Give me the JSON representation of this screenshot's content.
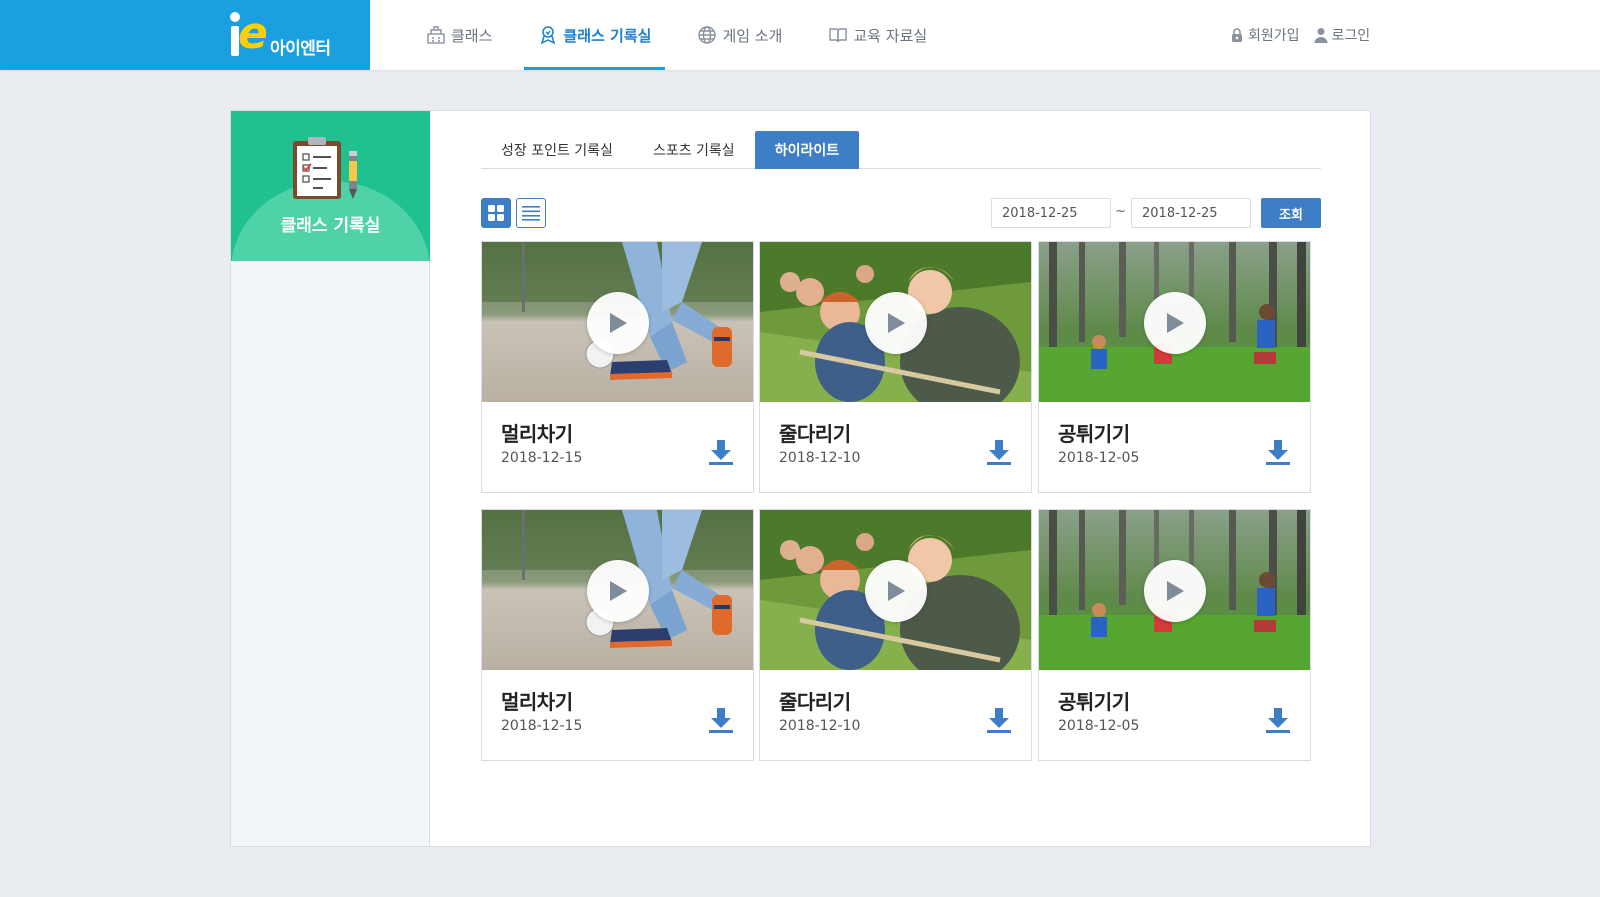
{
  "logo": {
    "text": "아이엔터"
  },
  "nav": [
    {
      "label": "클래스",
      "icon": "building-icon",
      "active": false
    },
    {
      "label": "클래스 기록실",
      "icon": "medal-icon",
      "active": true
    },
    {
      "label": "게임 소개",
      "icon": "globe-icon",
      "active": false
    },
    {
      "label": "교육 자료실",
      "icon": "book-icon",
      "active": false
    }
  ],
  "auth": {
    "signup": "회원가입",
    "login": "로그인"
  },
  "sidebar": {
    "title": "클래스 기록실",
    "icon": "clipboard-icon"
  },
  "tabs": [
    {
      "label": "성장 포인트 기록실",
      "active": false
    },
    {
      "label": "스포츠 기록실",
      "active": false
    },
    {
      "label": "하이라이트",
      "active": true
    }
  ],
  "toolbar": {
    "view_modes": [
      "grid",
      "list"
    ],
    "date_from": "2018-12-25",
    "date_sep": "~",
    "date_to": "2018-12-25",
    "search_label": "조회"
  },
  "videos": [
    {
      "title": "멀리차기",
      "date": "2018-12-15",
      "thumb": "kick"
    },
    {
      "title": "줄다리기",
      "date": "2018-12-10",
      "thumb": "tug"
    },
    {
      "title": "공튀기기",
      "date": "2018-12-05",
      "thumb": "forest"
    },
    {
      "title": "멀리차기",
      "date": "2018-12-15",
      "thumb": "kick"
    },
    {
      "title": "줄다리기",
      "date": "2018-12-10",
      "thumb": "tug"
    },
    {
      "title": "공튀기기",
      "date": "2018-12-05",
      "thumb": "forest"
    }
  ],
  "colors": {
    "brand": "#1a9fe0",
    "accent": "#3d7ec7",
    "sidebar": "#20c08f"
  }
}
